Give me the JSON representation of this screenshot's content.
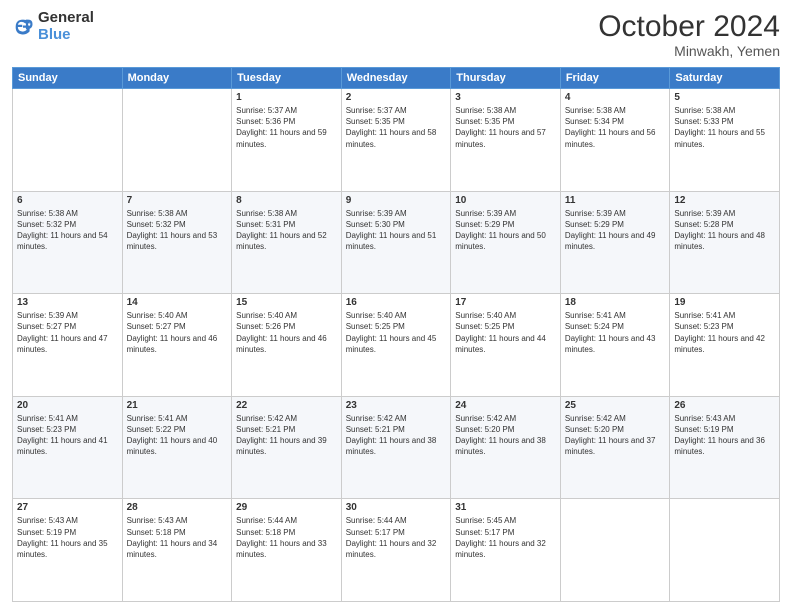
{
  "header": {
    "logo": {
      "line1": "General",
      "line2": "Blue"
    },
    "title": "October 2024",
    "location": "Minwakh, Yemen"
  },
  "weekdays": [
    "Sunday",
    "Monday",
    "Tuesday",
    "Wednesday",
    "Thursday",
    "Friday",
    "Saturday"
  ],
  "weeks": [
    [
      {
        "day": "",
        "sunrise": "",
        "sunset": "",
        "daylight": ""
      },
      {
        "day": "",
        "sunrise": "",
        "sunset": "",
        "daylight": ""
      },
      {
        "day": "1",
        "sunrise": "Sunrise: 5:37 AM",
        "sunset": "Sunset: 5:36 PM",
        "daylight": "Daylight: 11 hours and 59 minutes."
      },
      {
        "day": "2",
        "sunrise": "Sunrise: 5:37 AM",
        "sunset": "Sunset: 5:35 PM",
        "daylight": "Daylight: 11 hours and 58 minutes."
      },
      {
        "day": "3",
        "sunrise": "Sunrise: 5:38 AM",
        "sunset": "Sunset: 5:35 PM",
        "daylight": "Daylight: 11 hours and 57 minutes."
      },
      {
        "day": "4",
        "sunrise": "Sunrise: 5:38 AM",
        "sunset": "Sunset: 5:34 PM",
        "daylight": "Daylight: 11 hours and 56 minutes."
      },
      {
        "day": "5",
        "sunrise": "Sunrise: 5:38 AM",
        "sunset": "Sunset: 5:33 PM",
        "daylight": "Daylight: 11 hours and 55 minutes."
      }
    ],
    [
      {
        "day": "6",
        "sunrise": "Sunrise: 5:38 AM",
        "sunset": "Sunset: 5:32 PM",
        "daylight": "Daylight: 11 hours and 54 minutes."
      },
      {
        "day": "7",
        "sunrise": "Sunrise: 5:38 AM",
        "sunset": "Sunset: 5:32 PM",
        "daylight": "Daylight: 11 hours and 53 minutes."
      },
      {
        "day": "8",
        "sunrise": "Sunrise: 5:38 AM",
        "sunset": "Sunset: 5:31 PM",
        "daylight": "Daylight: 11 hours and 52 minutes."
      },
      {
        "day": "9",
        "sunrise": "Sunrise: 5:39 AM",
        "sunset": "Sunset: 5:30 PM",
        "daylight": "Daylight: 11 hours and 51 minutes."
      },
      {
        "day": "10",
        "sunrise": "Sunrise: 5:39 AM",
        "sunset": "Sunset: 5:29 PM",
        "daylight": "Daylight: 11 hours and 50 minutes."
      },
      {
        "day": "11",
        "sunrise": "Sunrise: 5:39 AM",
        "sunset": "Sunset: 5:29 PM",
        "daylight": "Daylight: 11 hours and 49 minutes."
      },
      {
        "day": "12",
        "sunrise": "Sunrise: 5:39 AM",
        "sunset": "Sunset: 5:28 PM",
        "daylight": "Daylight: 11 hours and 48 minutes."
      }
    ],
    [
      {
        "day": "13",
        "sunrise": "Sunrise: 5:39 AM",
        "sunset": "Sunset: 5:27 PM",
        "daylight": "Daylight: 11 hours and 47 minutes."
      },
      {
        "day": "14",
        "sunrise": "Sunrise: 5:40 AM",
        "sunset": "Sunset: 5:27 PM",
        "daylight": "Daylight: 11 hours and 46 minutes."
      },
      {
        "day": "15",
        "sunrise": "Sunrise: 5:40 AM",
        "sunset": "Sunset: 5:26 PM",
        "daylight": "Daylight: 11 hours and 46 minutes."
      },
      {
        "day": "16",
        "sunrise": "Sunrise: 5:40 AM",
        "sunset": "Sunset: 5:25 PM",
        "daylight": "Daylight: 11 hours and 45 minutes."
      },
      {
        "day": "17",
        "sunrise": "Sunrise: 5:40 AM",
        "sunset": "Sunset: 5:25 PM",
        "daylight": "Daylight: 11 hours and 44 minutes."
      },
      {
        "day": "18",
        "sunrise": "Sunrise: 5:41 AM",
        "sunset": "Sunset: 5:24 PM",
        "daylight": "Daylight: 11 hours and 43 minutes."
      },
      {
        "day": "19",
        "sunrise": "Sunrise: 5:41 AM",
        "sunset": "Sunset: 5:23 PM",
        "daylight": "Daylight: 11 hours and 42 minutes."
      }
    ],
    [
      {
        "day": "20",
        "sunrise": "Sunrise: 5:41 AM",
        "sunset": "Sunset: 5:23 PM",
        "daylight": "Daylight: 11 hours and 41 minutes."
      },
      {
        "day": "21",
        "sunrise": "Sunrise: 5:41 AM",
        "sunset": "Sunset: 5:22 PM",
        "daylight": "Daylight: 11 hours and 40 minutes."
      },
      {
        "day": "22",
        "sunrise": "Sunrise: 5:42 AM",
        "sunset": "Sunset: 5:21 PM",
        "daylight": "Daylight: 11 hours and 39 minutes."
      },
      {
        "day": "23",
        "sunrise": "Sunrise: 5:42 AM",
        "sunset": "Sunset: 5:21 PM",
        "daylight": "Daylight: 11 hours and 38 minutes."
      },
      {
        "day": "24",
        "sunrise": "Sunrise: 5:42 AM",
        "sunset": "Sunset: 5:20 PM",
        "daylight": "Daylight: 11 hours and 38 minutes."
      },
      {
        "day": "25",
        "sunrise": "Sunrise: 5:42 AM",
        "sunset": "Sunset: 5:20 PM",
        "daylight": "Daylight: 11 hours and 37 minutes."
      },
      {
        "day": "26",
        "sunrise": "Sunrise: 5:43 AM",
        "sunset": "Sunset: 5:19 PM",
        "daylight": "Daylight: 11 hours and 36 minutes."
      }
    ],
    [
      {
        "day": "27",
        "sunrise": "Sunrise: 5:43 AM",
        "sunset": "Sunset: 5:19 PM",
        "daylight": "Daylight: 11 hours and 35 minutes."
      },
      {
        "day": "28",
        "sunrise": "Sunrise: 5:43 AM",
        "sunset": "Sunset: 5:18 PM",
        "daylight": "Daylight: 11 hours and 34 minutes."
      },
      {
        "day": "29",
        "sunrise": "Sunrise: 5:44 AM",
        "sunset": "Sunset: 5:18 PM",
        "daylight": "Daylight: 11 hours and 33 minutes."
      },
      {
        "day": "30",
        "sunrise": "Sunrise: 5:44 AM",
        "sunset": "Sunset: 5:17 PM",
        "daylight": "Daylight: 11 hours and 32 minutes."
      },
      {
        "day": "31",
        "sunrise": "Sunrise: 5:45 AM",
        "sunset": "Sunset: 5:17 PM",
        "daylight": "Daylight: 11 hours and 32 minutes."
      },
      {
        "day": "",
        "sunrise": "",
        "sunset": "",
        "daylight": ""
      },
      {
        "day": "",
        "sunrise": "",
        "sunset": "",
        "daylight": ""
      }
    ]
  ]
}
